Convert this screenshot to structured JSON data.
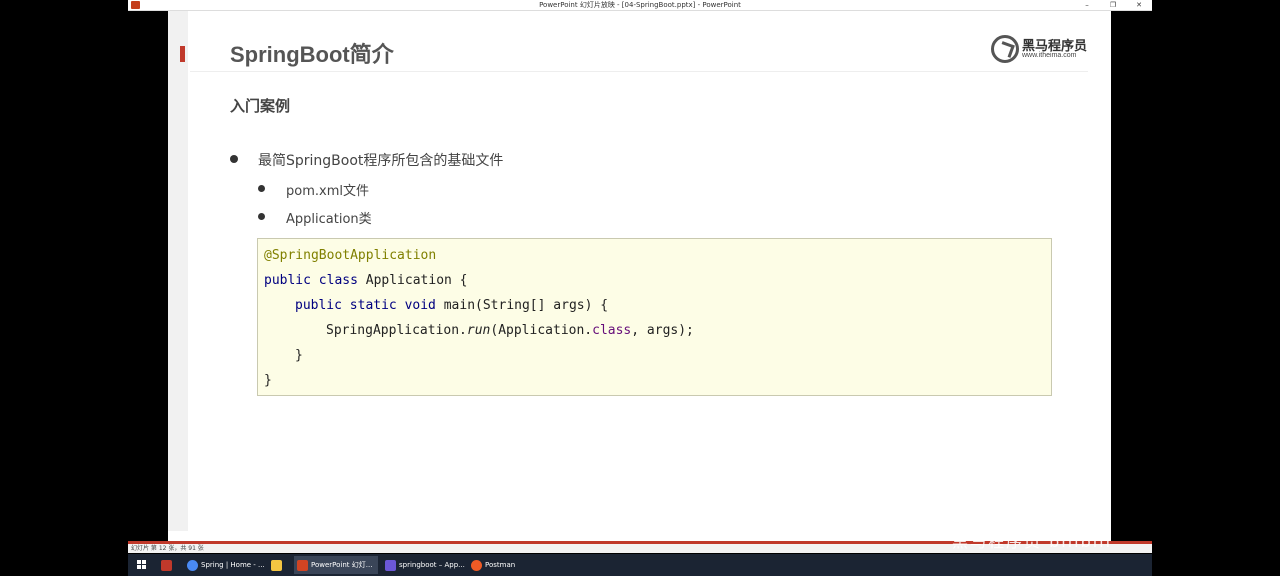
{
  "window": {
    "title": "PowerPoint 幻灯片放映 - [04-SpringBoot.pptx] - PowerPoint",
    "minimize": "–",
    "restore": "❐",
    "close": "✕"
  },
  "slide": {
    "title": "SpringBoot简介",
    "logo": {
      "name": "黑马程序员",
      "url": "www.itheima.com"
    },
    "subtitle": "入门案例",
    "bullets": [
      {
        "text": "最简SpringBoot程序所包含的基础文件",
        "level": 1
      },
      {
        "text": "pom.xml文件",
        "level": 2
      },
      {
        "text": "Application类",
        "level": 2
      }
    ],
    "code": {
      "annotation": "@SpringBootApplication",
      "line2_kw": "public class",
      "line2_rest": " Application {",
      "line3_kw": "public static void",
      "line3_rest": " main(String[] args) {",
      "line4_pre": "SpringApplication.",
      "line4_method": "run",
      "line4_mid": "(Application.",
      "line4_kw": "class",
      "line4_post": ", args);",
      "line5": "}",
      "line6": "}"
    }
  },
  "statusbar": {
    "text": "幻灯片 第 12 张，共 91 张"
  },
  "taskbar": {
    "items": [
      {
        "label": "Spring | Home - ...",
        "icon": "chrome-icon",
        "color": "#4a8af4"
      },
      {
        "label": "",
        "icon": "file-explorer-icon",
        "color": "#f4c542"
      },
      {
        "label": "PowerPoint 幻灯...",
        "icon": "powerpoint-icon",
        "color": "#d04423"
      },
      {
        "label": "springboot – App...",
        "icon": "intellij-icon",
        "color": "#6b57d6"
      },
      {
        "label": "Postman",
        "icon": "postman-icon",
        "color": "#ef5b25"
      }
    ]
  },
  "watermark": "黑马程序员 bilibili"
}
